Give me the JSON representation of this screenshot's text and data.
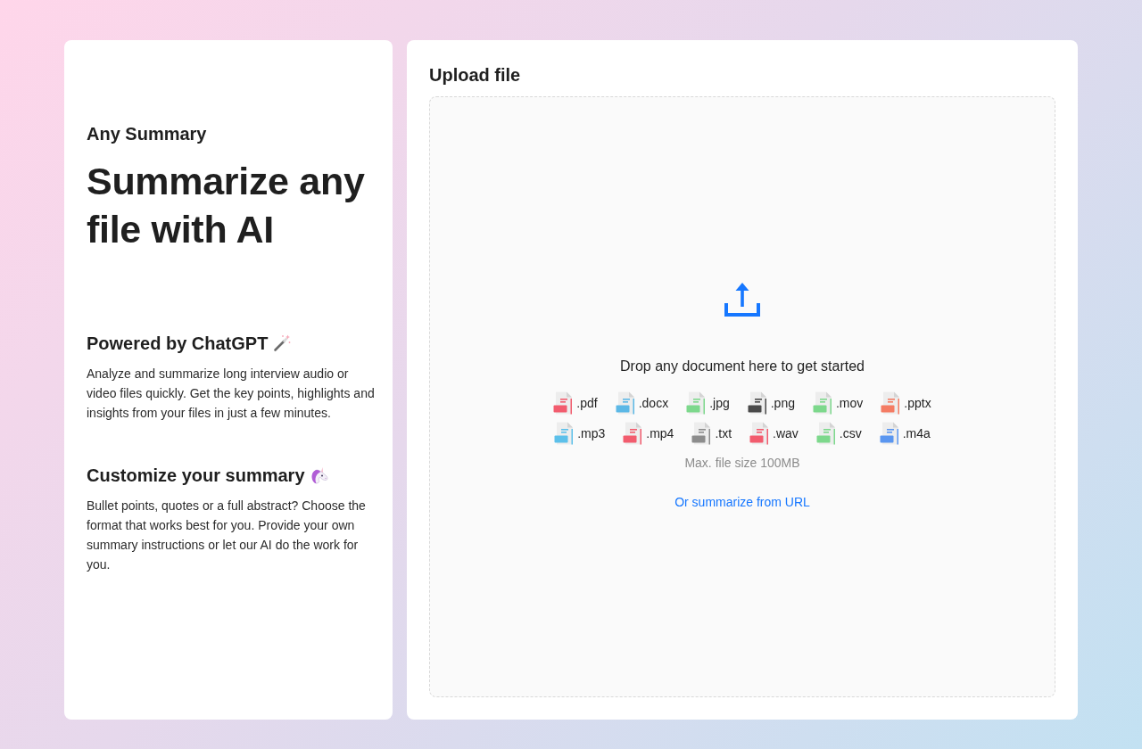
{
  "intro": {
    "eyebrow": "Any Summary",
    "headline": "Summarize any file with AI"
  },
  "features": [
    {
      "title": "Powered by ChatGPT",
      "text": "Analyze and summarize long interview audio or video files quickly. Get the key points, highlights and insights from your files in just a few minutes."
    },
    {
      "title": "Customize your summary",
      "text": "Bullet points, quotes or a full abstract? Choose the format that works best for you. Provide your own summary instructions or let our AI do the work for you."
    }
  ],
  "upload": {
    "title": "Upload file",
    "drop_zone": {
      "prompt": "Drop any document here to get started",
      "file_type_rows": [
        [
          {
            "label": ".pdf",
            "color": "#f25c6e"
          },
          {
            "label": ".docx",
            "color": "#5cb8e6"
          },
          {
            "label": ".jpg",
            "color": "#7dd88c"
          },
          {
            "label": ".png",
            "color": "#4a4a4a"
          },
          {
            "label": ".mov",
            "color": "#7dd88c"
          },
          {
            "label": ".pptx",
            "color": "#f47c64"
          }
        ],
        [
          {
            "label": ".mp3",
            "color": "#5cc0ea"
          },
          {
            "label": ".mp4",
            "color": "#f25c6e"
          },
          {
            "label": ".txt",
            "color": "#8c8c8c"
          },
          {
            "label": ".wav",
            "color": "#f25c6e"
          },
          {
            "label": ".csv",
            "color": "#7dd88c"
          },
          {
            "label": ".m4a",
            "color": "#5a96f0"
          }
        ]
      ],
      "size_limit": "Max. file size 100MB",
      "url_link": "Or summarize from URL"
    }
  }
}
